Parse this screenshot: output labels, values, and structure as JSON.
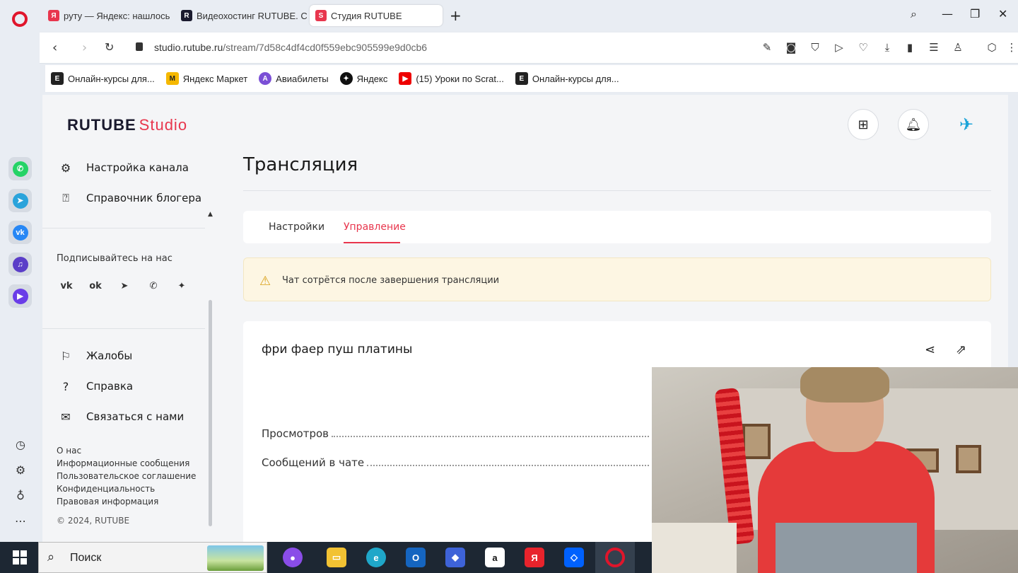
{
  "browser": {
    "tabs": [
      {
        "label": "руту — Яндекс: нашлось",
        "favicon": "Я",
        "color": "#e8364d"
      },
      {
        "label": "Видеохостинг RUTUBE. Смотр",
        "favicon": "R",
        "color": "#1a1a2e"
      },
      {
        "label": "Студия RUTUBE",
        "favicon": "S",
        "color": "#e8364d"
      }
    ],
    "url_host": "studio.rutube.ru",
    "url_path": "/stream/7d58c4df4cd0f559ebc905599e9d0cb6",
    "bookmarks": [
      {
        "label": "Онлайн-курсы для...",
        "icon": "E",
        "color": "#222"
      },
      {
        "label": "Яндекс Маркет",
        "icon": "M",
        "color": "#f5b800"
      },
      {
        "label": "Авиабилеты",
        "icon": "A",
        "color": "#7b4fd6"
      },
      {
        "label": "Яндекс",
        "icon": "✦",
        "color": "#111"
      },
      {
        "label": "(15) Уроки по Scrat...",
        "icon": "▶",
        "color": "#e00"
      },
      {
        "label": "Онлайн-курсы для...",
        "icon": "E",
        "color": "#222"
      }
    ]
  },
  "header": {
    "logo_main": "RUTUBE",
    "logo_studio": "Studio"
  },
  "sidebar": {
    "items_top": [
      {
        "label": "Настройка канала",
        "icon": "gear-icon"
      },
      {
        "label": "Справочник блогера",
        "icon": "book-icon"
      }
    ],
    "follow_label": "Подписывайтесь на нас",
    "social": [
      "vk",
      "ok",
      "telegram",
      "viber",
      "zen"
    ],
    "items_bottom": [
      {
        "label": "Жалобы",
        "icon": "flag-icon"
      },
      {
        "label": "Справка",
        "icon": "help-icon"
      },
      {
        "label": "Связаться с нами",
        "icon": "mail-icon"
      }
    ],
    "footer_links": [
      "О нас",
      "Информационные сообщения",
      "Пользовательское соглашение",
      "Конфиденциальность",
      "Правовая информация"
    ],
    "copyright": "© 2024, RUTUBE"
  },
  "main": {
    "title": "Трансляция",
    "tabs": [
      "Настройки",
      "Управление"
    ],
    "active_tab": "Управление",
    "warning": "Чат сотрётся после завершения трансляции",
    "stream_title": "фри фаер пуш платины",
    "stats": [
      "Просмотров",
      "Сообщений в чате"
    ]
  },
  "taskbar": {
    "search_label": "Поиск"
  },
  "colors": {
    "accent": "#e8364d",
    "warning_bg": "#fdf6e3"
  }
}
